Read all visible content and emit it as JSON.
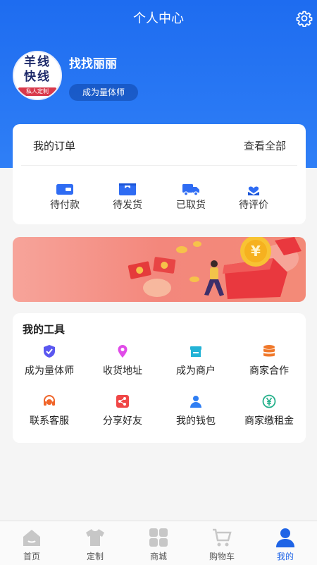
{
  "header": {
    "title": "个人中心"
  },
  "profile": {
    "username": "找找丽丽",
    "cert_button": "成为量体师",
    "avatar_logo": {
      "line1": "羊线",
      "line2": "快线",
      "ribbon": "私人定制"
    }
  },
  "orders": {
    "title": "我的订单",
    "view_all": "查看全部",
    "items": [
      {
        "label": "待付款",
        "icon": "wallet-icon"
      },
      {
        "label": "待发货",
        "icon": "package-icon"
      },
      {
        "label": "已取货",
        "icon": "truck-icon"
      },
      {
        "label": "待评价",
        "icon": "heart-hand-icon"
      }
    ]
  },
  "banner": {
    "description_icon": "gift-box-coins-illustration"
  },
  "tools": {
    "title": "我的工具",
    "items": [
      {
        "label": "成为量体师",
        "icon": "shield-check-icon",
        "color": "#5a57f0"
      },
      {
        "label": "收货地址",
        "icon": "location-pin-icon",
        "color": "#e04be8"
      },
      {
        "label": "成为商户",
        "icon": "store-icon",
        "color": "#23b3d6"
      },
      {
        "label": "商家合作",
        "icon": "database-stack-icon",
        "color": "#f0782a"
      },
      {
        "label": "联系客服",
        "icon": "headset-icon",
        "color": "#f0652a"
      },
      {
        "label": "分享好友",
        "icon": "share-icon",
        "color": "#f04747"
      },
      {
        "label": "我的钱包",
        "icon": "user-wallet-icon",
        "color": "#2f7ef3"
      },
      {
        "label": "商家缴租金",
        "icon": "yen-coin-icon",
        "color": "#23b08a"
      }
    ]
  },
  "tabbar": {
    "items": [
      {
        "label": "首页",
        "icon": "home-icon",
        "active": false
      },
      {
        "label": "定制",
        "icon": "tshirt-icon",
        "active": false
      },
      {
        "label": "商城",
        "icon": "grid-icon",
        "active": false
      },
      {
        "label": "购物车",
        "icon": "cart-icon",
        "active": false
      },
      {
        "label": "我的",
        "icon": "user-icon",
        "active": true
      }
    ]
  },
  "colors": {
    "primary": "#1f64e6",
    "accent": "#2f7ff6",
    "tab_inactive": "#c7c7c7"
  }
}
